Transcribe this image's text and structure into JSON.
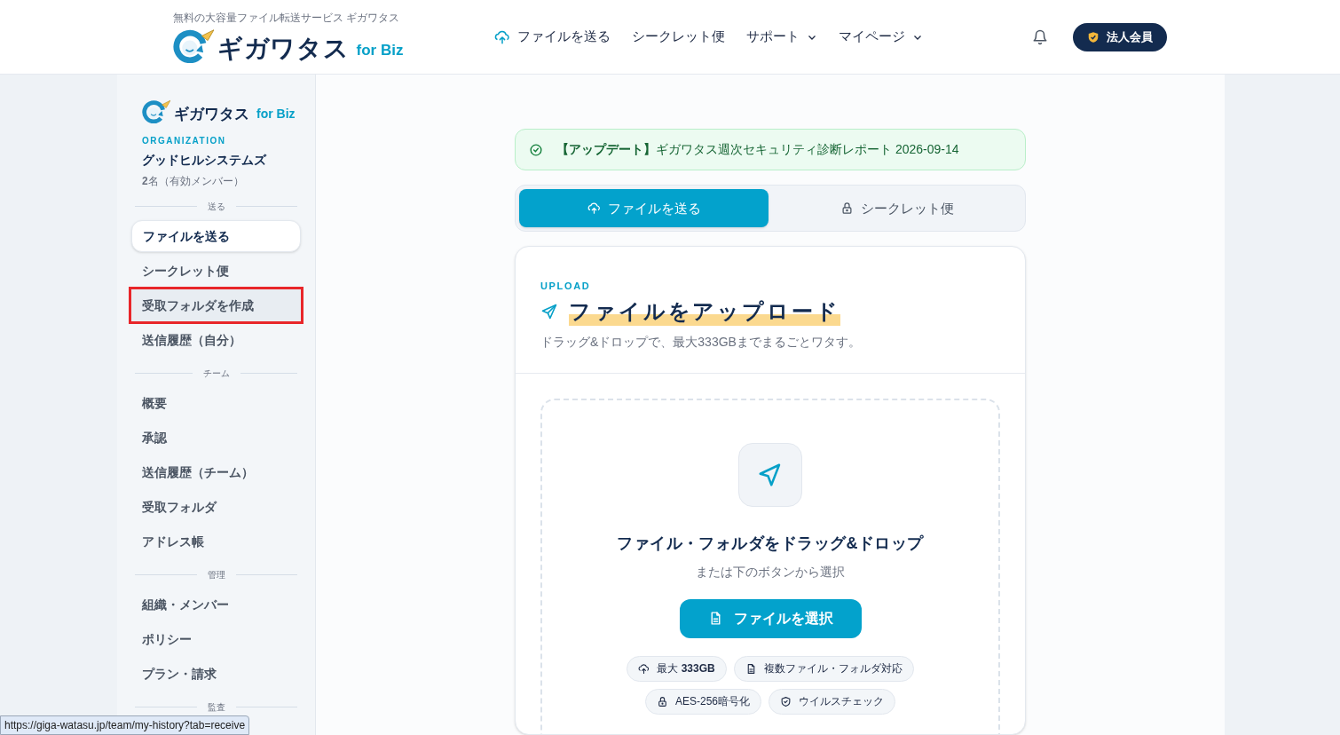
{
  "header": {
    "tagline": "無料の大容量ファイル転送サービス ギガワタス",
    "logo": {
      "name": "ギガワタス",
      "suffix": "for Biz"
    },
    "nav": [
      {
        "label": "ファイルを送る",
        "kind": "upload"
      },
      {
        "label": "シークレット便",
        "kind": "plain"
      },
      {
        "label": "サポート",
        "kind": "dropdown"
      },
      {
        "label": "マイページ",
        "kind": "dropdown"
      }
    ],
    "badge": "法人会員"
  },
  "sidebar": {
    "logo": {
      "name": "ギガワタス",
      "suffix": "for Biz"
    },
    "org_label": "ORGANIZATION",
    "org_name": "グッドヒルシステムズ",
    "member_count": "**2**名（有効メンバー）",
    "sections": [
      {
        "heading": "送る",
        "items": [
          {
            "label": "ファイルを送る",
            "selected": true,
            "highlighted": false
          },
          {
            "label": "シークレット便",
            "selected": false,
            "highlighted": false
          },
          {
            "label": "受取フォルダを作成",
            "selected": false,
            "highlighted": true
          },
          {
            "label": "送信履歴（自分）",
            "selected": false,
            "highlighted": false
          }
        ]
      },
      {
        "heading": "チーム",
        "items": [
          {
            "label": "概要",
            "selected": false,
            "highlighted": false
          },
          {
            "label": "承認",
            "selected": false,
            "highlighted": false
          },
          {
            "label": "送信履歴（チーム）",
            "selected": false,
            "highlighted": false
          },
          {
            "label": "受取フォルダ",
            "selected": false,
            "highlighted": false
          },
          {
            "label": "アドレス帳",
            "selected": false,
            "highlighted": false
          }
        ]
      },
      {
        "heading": "管理",
        "items": [
          {
            "label": "組織・メンバー",
            "selected": false,
            "highlighted": false
          },
          {
            "label": "ポリシー",
            "selected": false,
            "highlighted": false
          },
          {
            "label": "プラン・請求",
            "selected": false,
            "highlighted": false
          }
        ]
      },
      {
        "heading": "監査"
      }
    ]
  },
  "main": {
    "notice": "**【アップデート】**ギガワタス週次セキュリティ診断レポート 2026-09-14",
    "tabs": [
      {
        "label": "ファイルを送る",
        "selected": true
      },
      {
        "label": "シークレット便",
        "selected": false
      }
    ],
    "upload": {
      "eyebrow": "UPLOAD",
      "title": "ファイルをアップロード",
      "subtitle": "ドラッグ&ドロップで、最大333GBまでまるごとワタす。",
      "drop_title": "ファイル・フォルダをドラッグ&ドロップ",
      "drop_hint": "または下のボタンから選択",
      "button": "ファイルを選択",
      "features": [
        {
          "text": "最大 **333GB**"
        },
        {
          "text": "複数ファイル・フォルダ対応"
        },
        {
          "text": "AES-256暗号化"
        },
        {
          "text": "ウイルスチェック"
        }
      ]
    }
  },
  "link_preview": "https://giga-watasu.jp/team/my-history?tab=receive"
}
